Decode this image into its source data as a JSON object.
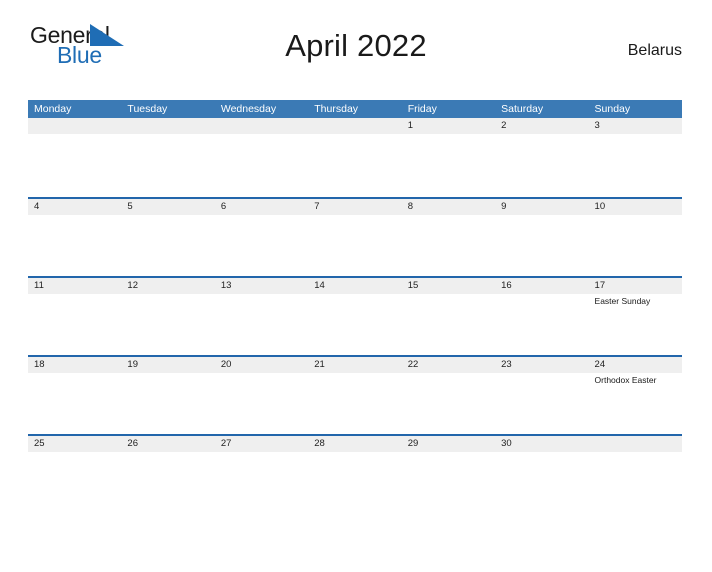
{
  "brand": {
    "name_top": "General",
    "name_bottom": "Blue",
    "top_color": "#1b1b1b",
    "bottom_color": "#1f6db5",
    "triangle_color": "#1f6db5"
  },
  "header": {
    "title": "April 2022",
    "country": "Belarus"
  },
  "colors": {
    "header_bg": "#3b7ab5",
    "header_text": "#ffffff",
    "row_rule": "#2266ab",
    "day_band_bg": "#efefef",
    "page_bg": "#ffffff"
  },
  "calendar": {
    "weekdays": [
      "Monday",
      "Tuesday",
      "Wednesday",
      "Thursday",
      "Friday",
      "Saturday",
      "Sunday"
    ],
    "weeks": [
      {
        "days": [
          {
            "date": "",
            "events": []
          },
          {
            "date": "",
            "events": []
          },
          {
            "date": "",
            "events": []
          },
          {
            "date": "",
            "events": []
          },
          {
            "date": "1",
            "events": []
          },
          {
            "date": "2",
            "events": []
          },
          {
            "date": "3",
            "events": []
          }
        ]
      },
      {
        "days": [
          {
            "date": "4",
            "events": []
          },
          {
            "date": "5",
            "events": []
          },
          {
            "date": "6",
            "events": []
          },
          {
            "date": "7",
            "events": []
          },
          {
            "date": "8",
            "events": []
          },
          {
            "date": "9",
            "events": []
          },
          {
            "date": "10",
            "events": []
          }
        ]
      },
      {
        "days": [
          {
            "date": "11",
            "events": []
          },
          {
            "date": "12",
            "events": []
          },
          {
            "date": "13",
            "events": []
          },
          {
            "date": "14",
            "events": []
          },
          {
            "date": "15",
            "events": []
          },
          {
            "date": "16",
            "events": []
          },
          {
            "date": "17",
            "events": [
              "Easter Sunday"
            ]
          }
        ]
      },
      {
        "days": [
          {
            "date": "18",
            "events": []
          },
          {
            "date": "19",
            "events": []
          },
          {
            "date": "20",
            "events": []
          },
          {
            "date": "21",
            "events": []
          },
          {
            "date": "22",
            "events": []
          },
          {
            "date": "23",
            "events": []
          },
          {
            "date": "24",
            "events": [
              "Orthodox Easter"
            ]
          }
        ]
      },
      {
        "days": [
          {
            "date": "25",
            "events": []
          },
          {
            "date": "26",
            "events": []
          },
          {
            "date": "27",
            "events": []
          },
          {
            "date": "28",
            "events": []
          },
          {
            "date": "29",
            "events": []
          },
          {
            "date": "30",
            "events": []
          },
          {
            "date": "",
            "events": []
          }
        ]
      }
    ]
  }
}
